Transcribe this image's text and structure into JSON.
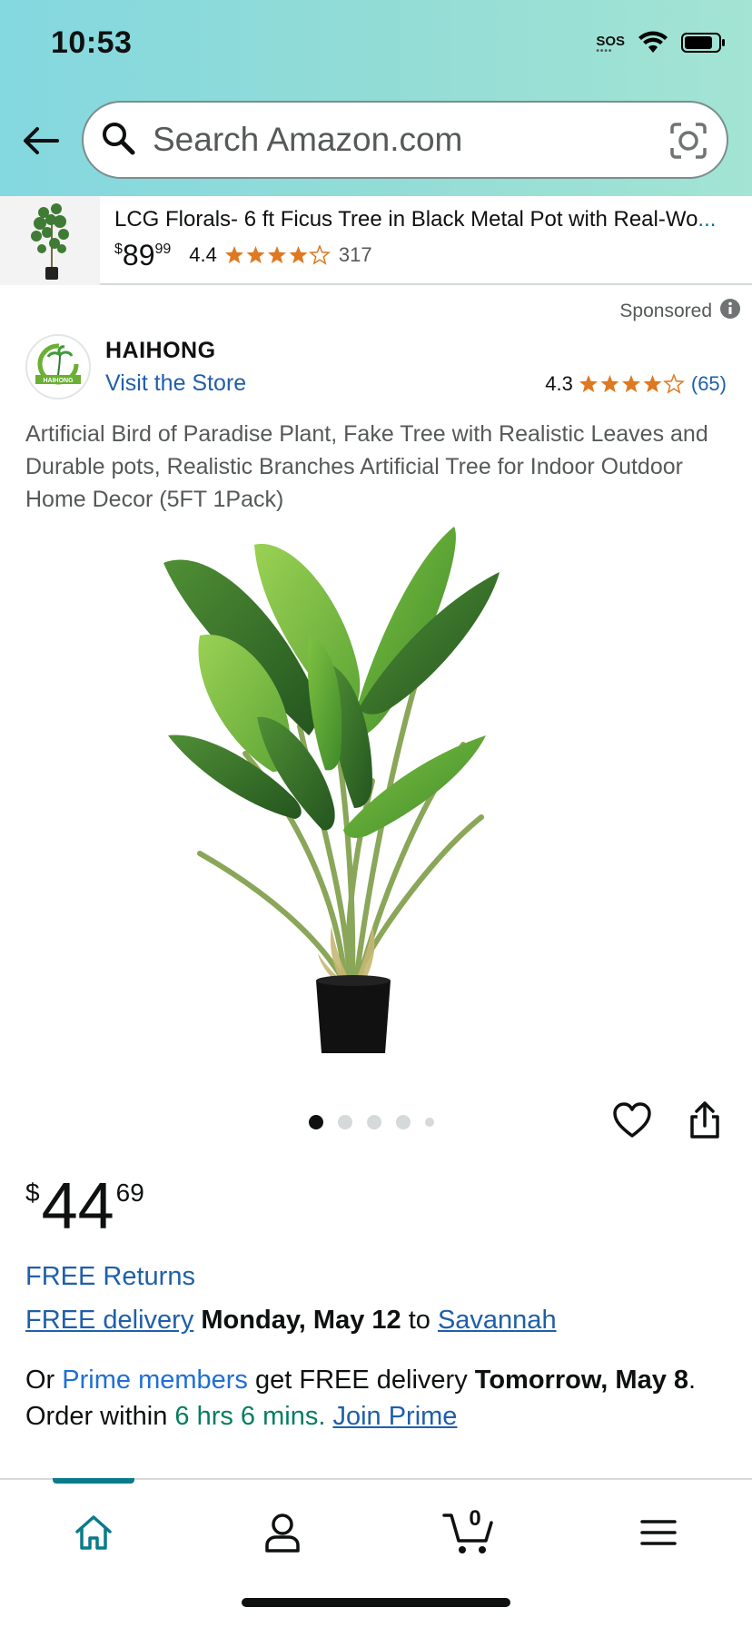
{
  "status_bar": {
    "time": "10:53",
    "sos": "SOS"
  },
  "search": {
    "placeholder": "Search Amazon.com"
  },
  "related_product": {
    "title": "LCG Florals- 6 ft Ficus Tree in Black Metal Pot with Real-Wo",
    "ellipsis": "...",
    "price_symbol": "$",
    "price_whole": "89",
    "price_fraction": "99",
    "rating": "4.4",
    "rating_stars": 4.5,
    "review_count": "317"
  },
  "sponsored_label": "Sponsored",
  "brand": {
    "name": "HAIHONG",
    "visit_store": "Visit the Store",
    "logo_text": "HAIHONG"
  },
  "rating": {
    "value": "4.3",
    "stars": 4.5,
    "count": "(65)"
  },
  "product": {
    "title": "Artificial Bird of Paradise Plant, Fake Tree with Realistic Leaves and Durable pots, Realistic Branches Artificial Tree for Indoor Outdoor Home Decor (5FT 1Pack)",
    "price_symbol": "$",
    "price_whole": "44",
    "price_fraction": "69",
    "image_count": 5,
    "active_image": 1
  },
  "delivery": {
    "free_returns": "FREE Returns",
    "free_delivery": "FREE delivery",
    "date": "Monday, May 12",
    "to": "to",
    "location": "Savannah"
  },
  "prime": {
    "or": "Or",
    "members": "Prime members",
    "get_free": "get FREE delivery",
    "tomorrow": "Tomorrow, May 8",
    "period": ".",
    "order_within": "Order within",
    "countdown": "6 hrs 6 mins.",
    "join": "Join Prime"
  },
  "bottom_nav": {
    "items": [
      "home-icon",
      "account-icon",
      "cart-icon",
      "menu-icon"
    ],
    "cart_count": "0",
    "active_color": "#0a7b8b"
  },
  "colors": {
    "link": "#1f5faa",
    "star": "#de7921",
    "prime_blue": "#1f6fd6",
    "countdown_green": "#067d62"
  }
}
